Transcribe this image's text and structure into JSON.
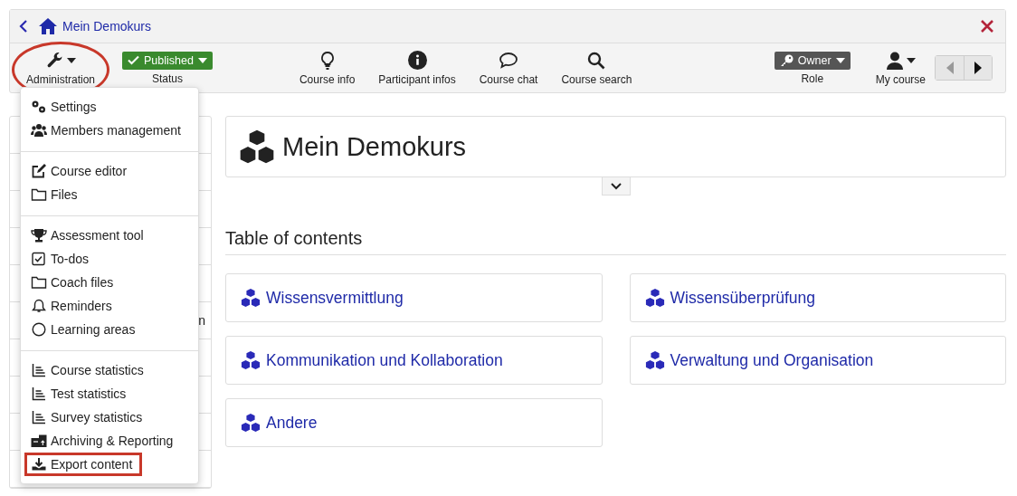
{
  "header": {
    "title": "Mein Demokurs"
  },
  "toolbar": {
    "left": [
      {
        "kind": "wrench",
        "label": "Administration",
        "dropdown": true,
        "circled": true
      },
      {
        "kind": "status",
        "badge": "Published",
        "label": "Status",
        "dropdown": true,
        "circled": false
      }
    ],
    "center": [
      {
        "kind": "bulb",
        "label": "Course info",
        "dropdown": false,
        "circled": false
      },
      {
        "kind": "info",
        "label": "Participant infos",
        "dropdown": false,
        "circled": false
      },
      {
        "kind": "chat",
        "label": "Course chat",
        "dropdown": false,
        "circled": false
      },
      {
        "kind": "search",
        "label": "Course search",
        "dropdown": false,
        "circled": false
      }
    ],
    "right": [
      {
        "kind": "role",
        "badge": "Owner",
        "label": "Role",
        "dropdown": true,
        "circled": false
      },
      {
        "kind": "user",
        "label": "My course",
        "dropdown": true,
        "circled": false
      }
    ],
    "pager": {
      "previous_disabled": true,
      "next_disabled": false
    }
  },
  "course_tree": {
    "partial_text": "n"
  },
  "admin_menu": {
    "groups": [
      {
        "items": [
          {
            "kind": "gears",
            "label": "Settings",
            "boxed": false
          },
          {
            "kind": "users",
            "label": "Members management",
            "boxed": false
          }
        ]
      },
      {
        "items": [
          {
            "kind": "edit",
            "label": "Course editor",
            "boxed": false
          },
          {
            "kind": "folder",
            "label": "Files",
            "boxed": false
          }
        ]
      },
      {
        "items": [
          {
            "kind": "trophy",
            "label": "Assessment tool",
            "boxed": false
          },
          {
            "kind": "check",
            "label": "To-dos",
            "boxed": false
          },
          {
            "kind": "folder",
            "label": "Coach files",
            "boxed": false
          },
          {
            "kind": "bell",
            "label": "Reminders",
            "boxed": false
          },
          {
            "kind": "circle",
            "label": "Learning areas",
            "boxed": false
          }
        ]
      },
      {
        "items": [
          {
            "kind": "stats",
            "label": "Course statistics",
            "boxed": false
          },
          {
            "kind": "stats",
            "label": "Test statistics",
            "boxed": false
          },
          {
            "kind": "stats",
            "label": "Survey statistics",
            "boxed": false
          },
          {
            "kind": "archive",
            "label": "Archiving & Reporting",
            "boxed": false
          },
          {
            "kind": "download",
            "label": "Export content",
            "boxed": true
          }
        ]
      }
    ]
  },
  "course": {
    "title": "Mein Demokurs",
    "toc_heading": "Table of contents",
    "entries": [
      {
        "label": "Wissensvermittlung"
      },
      {
        "label": "Wissensüberprüfung"
      },
      {
        "label": "Kommunikation und Kollaboration"
      },
      {
        "label": "Verwaltung und Organisation"
      },
      {
        "label": "Andere"
      }
    ]
  }
}
